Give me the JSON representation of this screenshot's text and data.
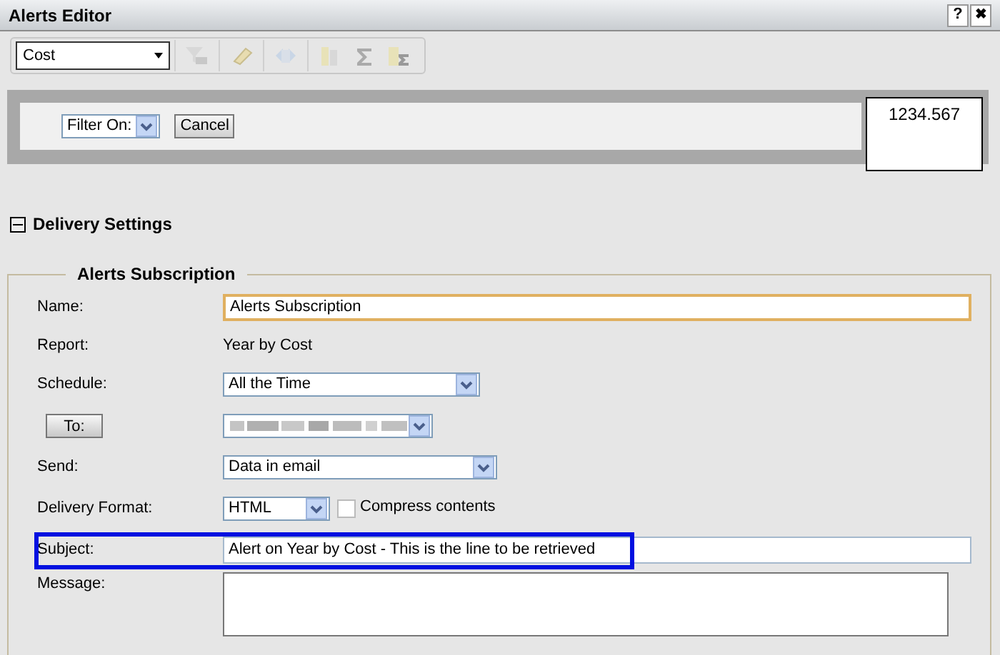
{
  "window": {
    "title": "Alerts Editor",
    "help": "?",
    "close": "✖"
  },
  "toolbar": {
    "measure_select": "Cost"
  },
  "filter": {
    "select": "Filter On:",
    "cancel": "Cancel",
    "value": "1234.567"
  },
  "section": {
    "title": "Delivery Settings",
    "expanded": true
  },
  "subscription": {
    "legend": "Alerts Subscription",
    "fields": [
      {
        "kind": "text",
        "label": "Name:",
        "value": "Alerts Subscription",
        "focused": true,
        "highlighted": false
      },
      {
        "kind": "static",
        "label": "Report:",
        "value": "Year by Cost"
      },
      {
        "kind": "select",
        "label": "Schedule:",
        "value": "All the Time"
      },
      {
        "kind": "button-select",
        "label": "To:"
      },
      {
        "kind": "select",
        "label": "Send:",
        "value": "Data in email"
      },
      {
        "kind": "select-checkbox",
        "label": "Delivery Format:",
        "value": "HTML",
        "checkbox_label": "Compress contents",
        "checked": false
      },
      {
        "kind": "text",
        "label": "Subject:",
        "value": "Alert on Year by Cost - This is the line to be retrieved",
        "focused": false,
        "highlighted": true
      },
      {
        "kind": "textarea",
        "label": "Message:"
      }
    ]
  }
}
